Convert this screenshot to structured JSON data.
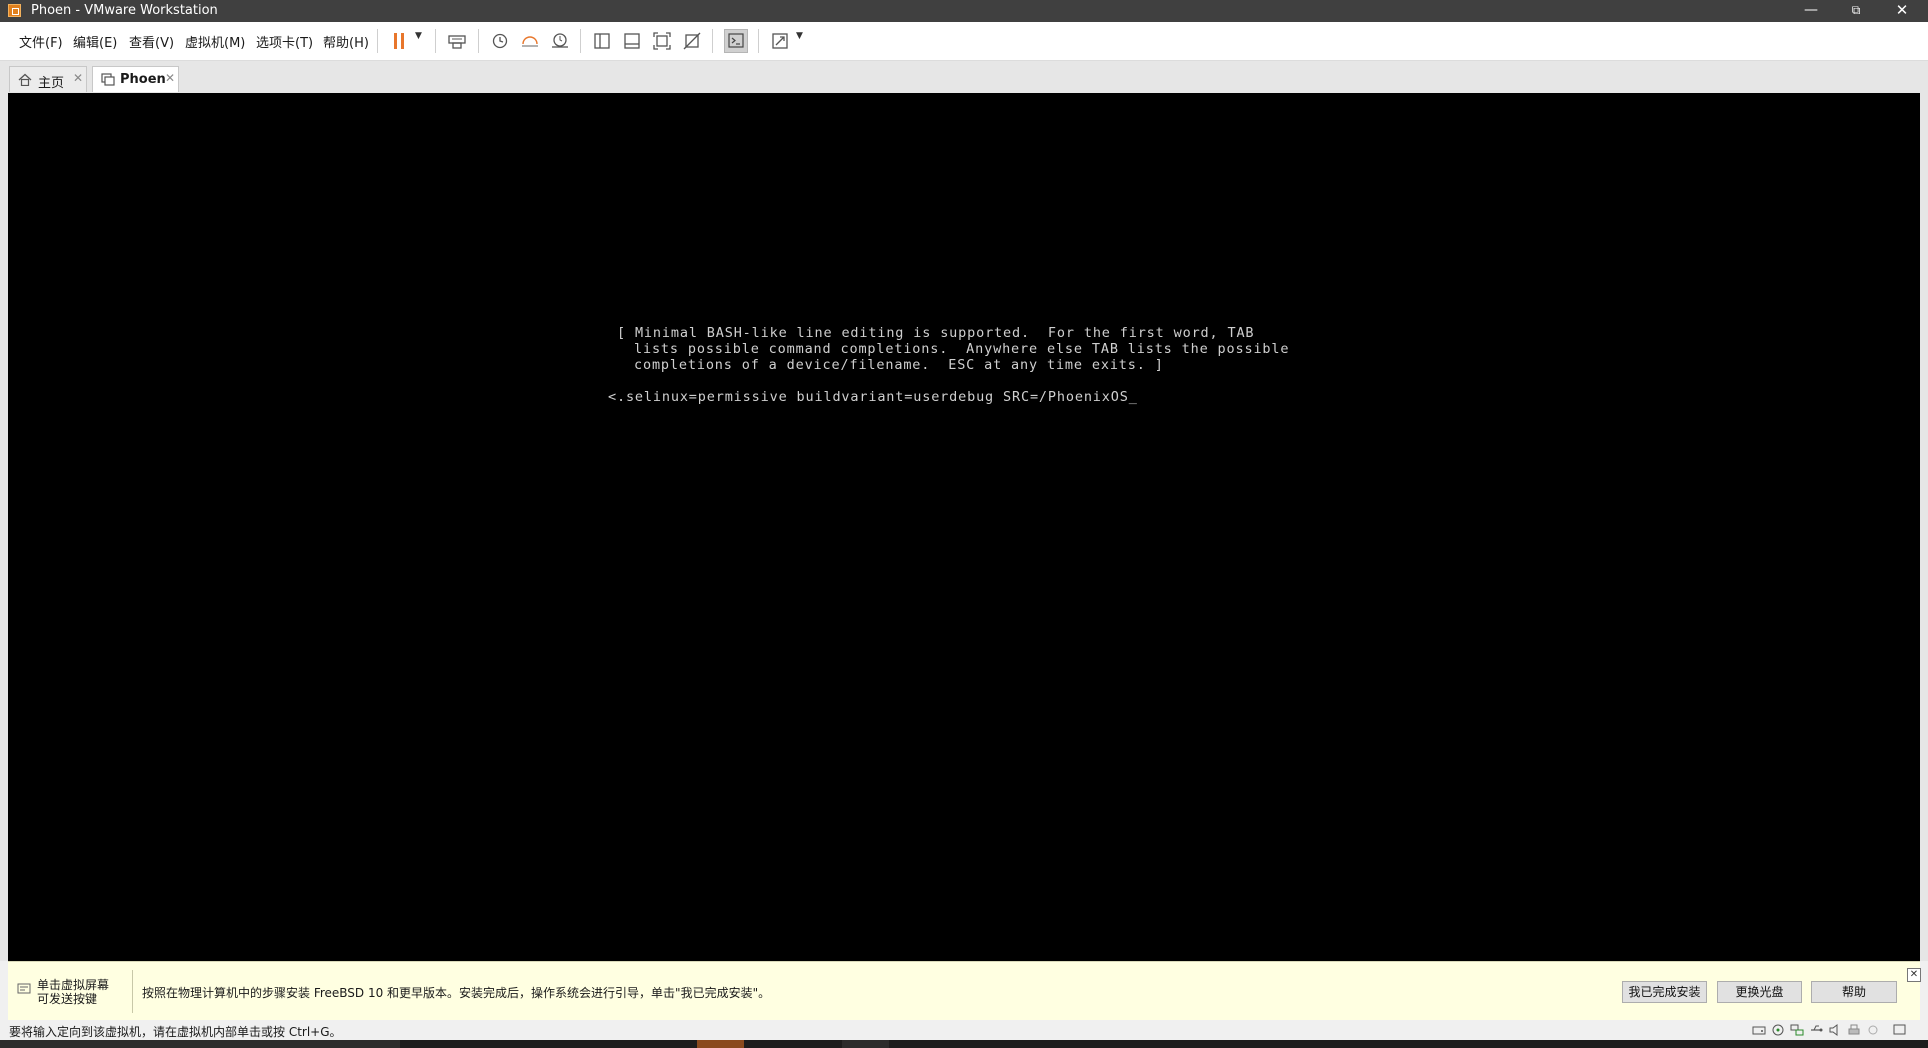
{
  "window": {
    "title": "Phoen - VMware Workstation"
  },
  "menu": [
    "文件(F)",
    "编辑(E)",
    "查看(V)",
    "虚拟机(M)",
    "选项卡(T)",
    "帮助(H)"
  ],
  "tabs": [
    {
      "label": "主页",
      "icon": "home-icon",
      "active": false
    },
    {
      "label": "Phoen",
      "icon": "vm-icon",
      "active": true
    }
  ],
  "console": {
    "lines": [
      "[ Minimal BASH-like line editing is supported.  For the first word, TAB",
      "lists possible command completions.  Anywhere else TAB lists the possible",
      "completions of a device/filename.  ESC at any time exits. ]",
      "<.selinux=permissive buildvariant=userdebug SRC=/PhoenixOS_"
    ]
  },
  "hint": {
    "left_lines": [
      "单击虚拟屏幕",
      "可发送按键"
    ],
    "message": "按照在物理计算机中的步骤安装 FreeBSD 10 和更早版本。安装完成后，操作系统会进行引导，单击\"我已完成安装\"。",
    "buttons": [
      "我已完成安装",
      "更换光盘",
      "帮助"
    ]
  },
  "status": {
    "text": "要将输入定向到该虚拟机，请在虚拟机内部单击或按 Ctrl+G。"
  },
  "colors": {
    "titlebar": "#404040",
    "pause_accent": "#e8762b",
    "hint_background": "#ffffe1",
    "console_background": "#000000"
  }
}
